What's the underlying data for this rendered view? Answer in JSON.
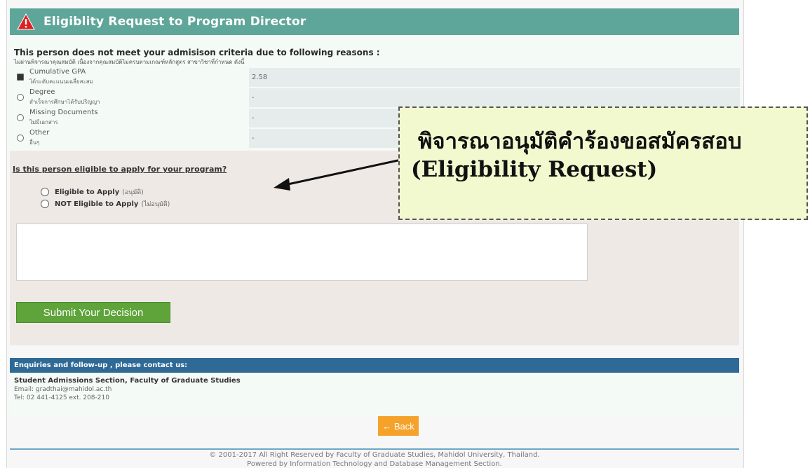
{
  "header": {
    "title": "Eligiblity Request to Program Director",
    "accent_color": "#5fa69a",
    "icon": "warning-icon"
  },
  "reasons": {
    "heading": "This person does not meet your admisison criteria due to following reasons :",
    "heading_th": "ไม่ผ่านพิจารณาคุณสมบัติ เนื่องจากคุณสมบัติไม่ครบตามเกณฑ์หลักสูตร สาขาวิชาที่กำหนด ดังนี้",
    "items": [
      {
        "label": "Cumulative GPA",
        "label_th": "ได้ระดับคะแนนเฉลี่ยสะสม",
        "value": "2.58",
        "checked": true
      },
      {
        "label": "Degree",
        "label_th": "สำเร็จการศึกษาได้รับปริญญา",
        "value": "-",
        "checked": false
      },
      {
        "label": "Missing Documents",
        "label_th": "ไม่มีเอกสาร",
        "value": "-",
        "checked": false
      },
      {
        "label": "Other",
        "label_th": "อื่นๆ",
        "value": "-",
        "checked": false
      }
    ]
  },
  "decision": {
    "question": "Is this person eligible to apply for your program?",
    "options": [
      {
        "label": "Eligible to Apply",
        "label_th": "(อนุมัติ)"
      },
      {
        "label": "NOT Eligible to Apply",
        "label_th": "(ไม่อนุมัติ)"
      }
    ],
    "comment_value": "",
    "submit_label": "Submit Your Decision"
  },
  "enquiries": {
    "bar_label": "Enquiries and follow-up , please contact us:",
    "section": "Student Admissions Section, Faculty of Graduate Studies",
    "email": "Email: gradthai@mahidol.ac.th",
    "tel": "Tel: 02 441-4125 ext. 208-210"
  },
  "back_label": "← Back",
  "footer": {
    "line1": "© 2001-2017 All Right Reserved by Faculty of Graduate Studies, Mahidol University, Thailand.",
    "line2": "Powered by Information Technology and Database Management Section."
  },
  "callout": {
    "line1": "พิจารณาอนุมัติคำร้องขอสมัครสอบ",
    "line2": "(Eligibility Request)"
  }
}
